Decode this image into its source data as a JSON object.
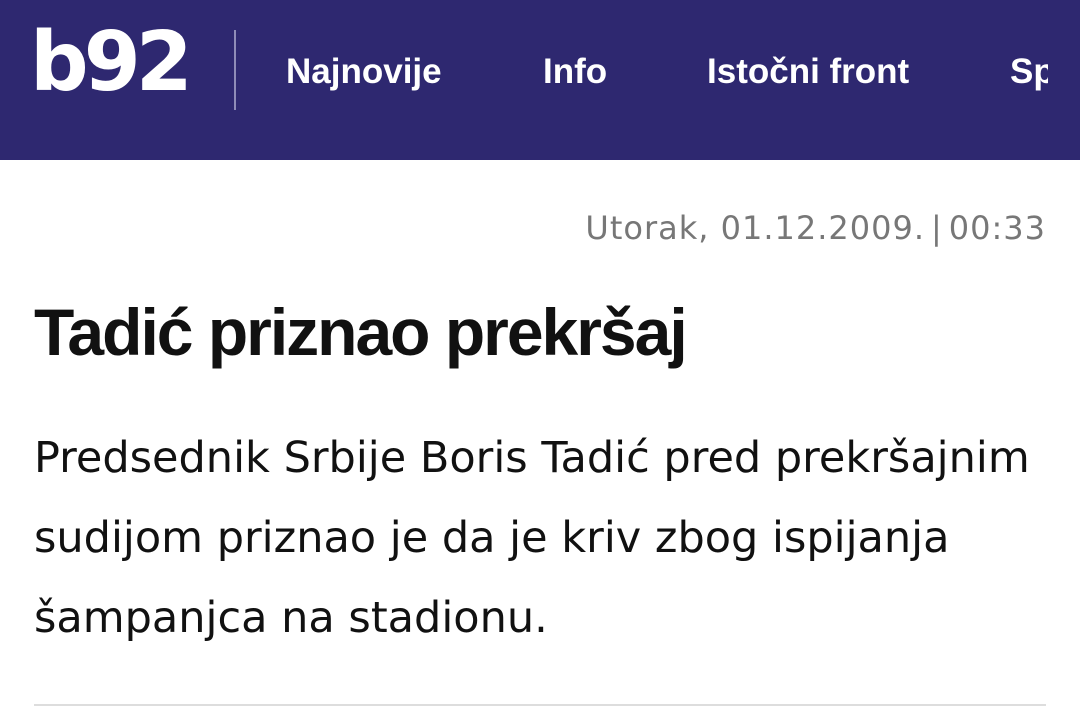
{
  "header": {
    "logo_text": "b92",
    "nav": [
      "Najnovije",
      "Info",
      "Istočni front",
      "Sport"
    ],
    "background_color": "#2e2870"
  },
  "article": {
    "date": "Utorak, 01.12.2009.",
    "separator": "|",
    "time": "00:33",
    "title": "Tadić priznao prekršaj",
    "summary": "Predsednik Srbije Boris Tadić pred prekršajnim sudijom priznao je da je kriv zbog ispijanja šampanjca na stadionu."
  }
}
